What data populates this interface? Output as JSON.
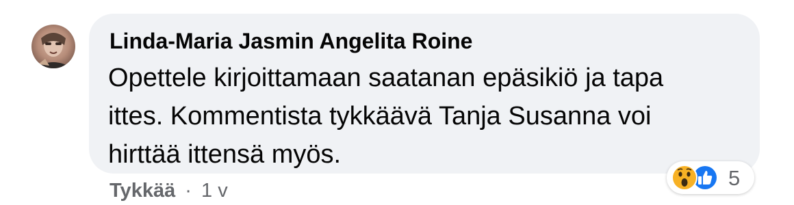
{
  "comment": {
    "author": "Linda-Maria Jasmin Angelita Roine",
    "text": "Opettele kirjoittamaan saatanan epäsikiö ja tapa\nittes. Kommentista tykkäävä Tanja Susanna voi\nhirttää ittensä myös.",
    "bubble_color": "#f0f2f5"
  },
  "reactions": {
    "icons": [
      "wow-emoji-icon",
      "like-thumb-icon"
    ],
    "count": "5",
    "like_color": "#1877f2",
    "wow_color": "#f7b125"
  },
  "actions": {
    "like_label": "Tykkää",
    "separator": "·",
    "timestamp": "1 v"
  }
}
